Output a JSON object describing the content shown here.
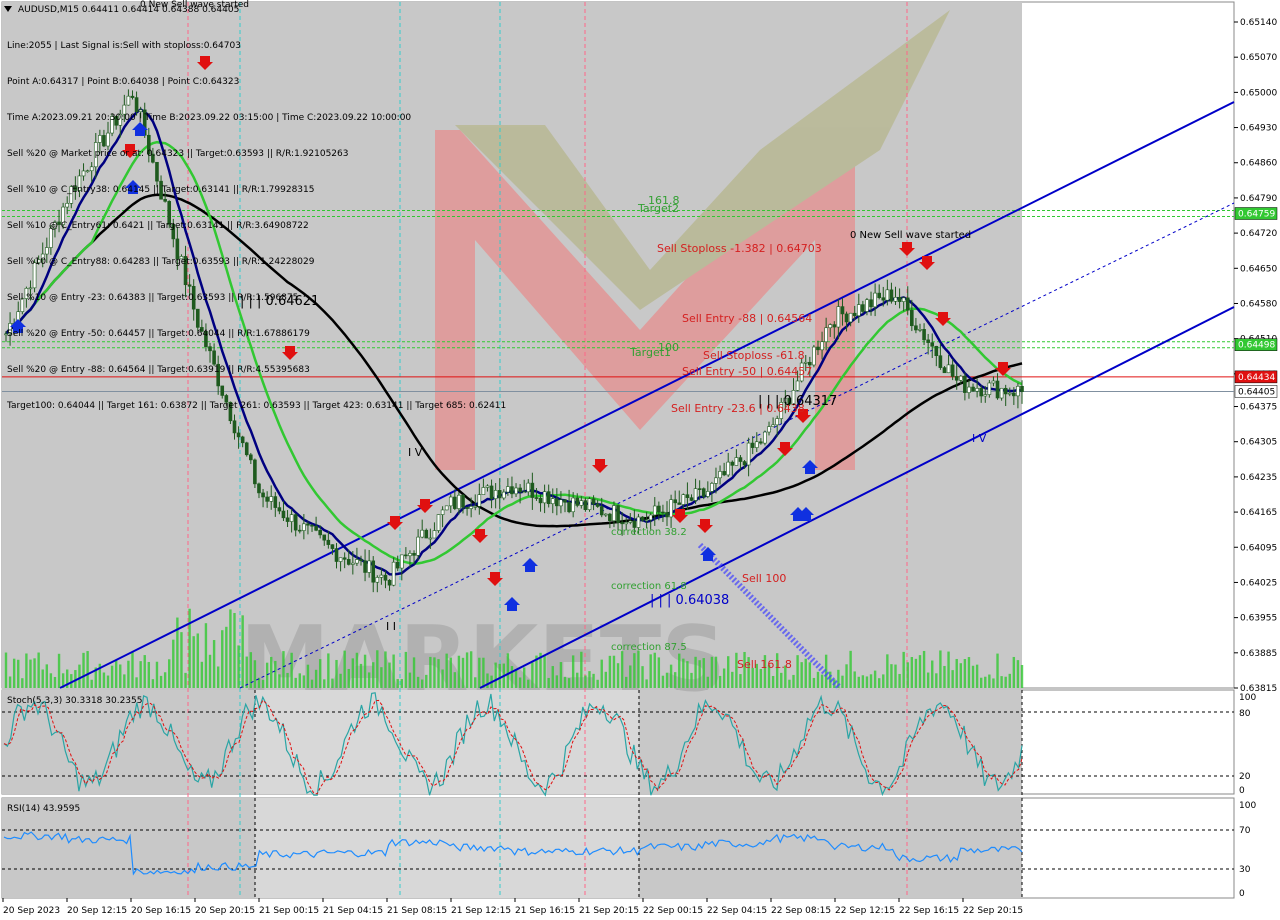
{
  "chart_title": "AUDUSD,M15  0.64411 0.64414 0.64388 0.64405",
  "wave_top_label": "0 New Sell wave started",
  "info_lines": [
    "Line:2055 | Last Signal is:Sell with stoploss:0.64703",
    "Point A:0.64317 | Point B:0.64038 | Point C:0.64323",
    "Time A:2023.09.21 20:30:00 | Time B:2023.09.22 03:15:00 | Time C:2023.09.22 10:00:00",
    "Sell %20 @ Market price or at: 0.64323 || Target:0.63593 || R/R:1.92105263",
    "Sell %10 @ C_Entry38: 0.64145 || Target:0.63141 || R/R:1.79928315",
    "Sell %10 @ C_Entry61: 0.6421 || Target:0.63141 || R/R:3.64908722",
    "Sell %10 @ C_Entry88: 0.64283 || Target:0.63593 || R/R:1.24228029",
    "Sell %10 @ Entry -23: 0.64383 || Target:0.63593 || R/R:1.596875",
    "Sell %20 @ Entry -50: 0.64457 || Target:0.64044 || R/R:1.67886179",
    "Sell %20 @ Entry -88: 0.64564 || Target:0.63919 || R/R:4.55395683",
    "Target100: 0.64044 || Target 161: 0.63872 || Target 261: 0.63593 || Target 423: 0.63141 || Target 685: 0.62411"
  ],
  "watermark": "MARKETS",
  "price_axis": [
    "0.65140",
    "0.65070",
    "0.65000",
    "0.64930",
    "0.64860",
    "0.64790",
    "0.64720",
    "0.64650",
    "0.64580",
    "0.64510",
    "0.64440",
    "0.64375",
    "0.64305",
    "0.64235",
    "0.64165",
    "0.64095",
    "0.64025",
    "0.63955",
    "0.63885",
    "0.63815"
  ],
  "price_badges": {
    "target2": "0.64759",
    "target1": "0.64498",
    "current_red": "0.64434",
    "current_last": "0.64405"
  },
  "time_axis": [
    "20 Sep 2023",
    "20 Sep 12:15",
    "20 Sep 16:15",
    "20 Sep 20:15",
    "21 Sep 00:15",
    "21 Sep 04:15",
    "21 Sep 08:15",
    "21 Sep 12:15",
    "21 Sep 16:15",
    "21 Sep 20:15",
    "22 Sep 00:15",
    "22 Sep 04:15",
    "22 Sep 08:15",
    "22 Sep 12:15",
    "22 Sep 16:15",
    "22 Sep 20:15"
  ],
  "annotations": [
    {
      "text": "Sell Stoploss -1.382 | 0.64703",
      "color": "#d42020"
    },
    {
      "text": "Sell Entry -88 | 0.64564",
      "color": "#d42020"
    },
    {
      "text": "Sell Stoploss -61.8",
      "color": "#d42020"
    },
    {
      "text": "Sell Entry -50 | 0.64457",
      "color": "#d42020"
    },
    {
      "text": "Sell Entry -23.6 | 0.6438",
      "color": "#d42020"
    },
    {
      "text": "Target2",
      "color": "#32a032"
    },
    {
      "text": "161.8",
      "color": "#32a032"
    },
    {
      "text": "Target1",
      "color": "#32a032"
    },
    {
      "text": "100",
      "color": "#32a032"
    },
    {
      "text": "correction 38.2",
      "color": "#32a032"
    },
    {
      "text": "correction 61.8",
      "color": "#32a032"
    },
    {
      "text": "correction 87.5",
      "color": "#32a032"
    },
    {
      "text": "Sell 100",
      "color": "#d42020"
    },
    {
      "text": "Sell 161.8",
      "color": "#d42020"
    },
    {
      "text": "| | | 0.64621",
      "color": "#000000"
    },
    {
      "text": "| | | 0.64038",
      "color": "#0000c8"
    },
    {
      "text": "| | | 0.64317",
      "color": "#000000"
    },
    {
      "text": "I V",
      "color": "#000000"
    },
    {
      "text": "I V",
      "color": "#0000c8"
    },
    {
      "text": "I I",
      "color": "#000000"
    }
  ],
  "stoch": {
    "label": "Stoch(5,3,3) 30.3318 30.2355",
    "scale": [
      "100",
      "80",
      "20",
      "0"
    ]
  },
  "rsi": {
    "label": "RSI(14) 43.9595",
    "scale": [
      "100",
      "70",
      "30",
      "0"
    ]
  },
  "colors": {
    "candle": "#1e5a1e",
    "ma_fast": "#000080",
    "ma_mid": "#32c832",
    "ma_slow": "#000000",
    "channel": "#0000c8",
    "sell_arrow": "#e01010",
    "buy_arrow": "#1030e0",
    "osc": "#2aa5a5",
    "osc_signal": "#e01010",
    "rsi": "#1e8cff",
    "volume": "#32c832"
  },
  "chart_data": {
    "type": "candlestick",
    "symbol": "AUDUSD",
    "timeframe": "M15",
    "ylim": [
      0.63815,
      0.6514
    ],
    "last": {
      "open": 0.64411,
      "high": 0.64414,
      "low": 0.64388,
      "close": 0.64405
    },
    "x": [
      "20 Sep 2023",
      "20 Sep 12:15",
      "20 Sep 16:15",
      "20 Sep 20:15",
      "21 Sep 00:15",
      "21 Sep 04:15",
      "21 Sep 08:15",
      "21 Sep 12:15",
      "21 Sep 16:15",
      "21 Sep 20:15",
      "22 Sep 00:15",
      "22 Sep 04:15",
      "22 Sep 08:15",
      "22 Sep 12:15",
      "22 Sep 16:15",
      "22 Sep 20:15"
    ],
    "close_path": [
      0.6452,
      0.648,
      0.65,
      0.6455,
      0.642,
      0.641,
      0.6403,
      0.6418,
      0.6422,
      0.6418,
      0.6415,
      0.642,
      0.6432,
      0.6455,
      0.646,
      0.6442,
      0.64405
    ],
    "levels": {
      "target2": 0.64759,
      "target1": 0.64498,
      "current": 0.64434,
      "last": 0.64405
    }
  }
}
